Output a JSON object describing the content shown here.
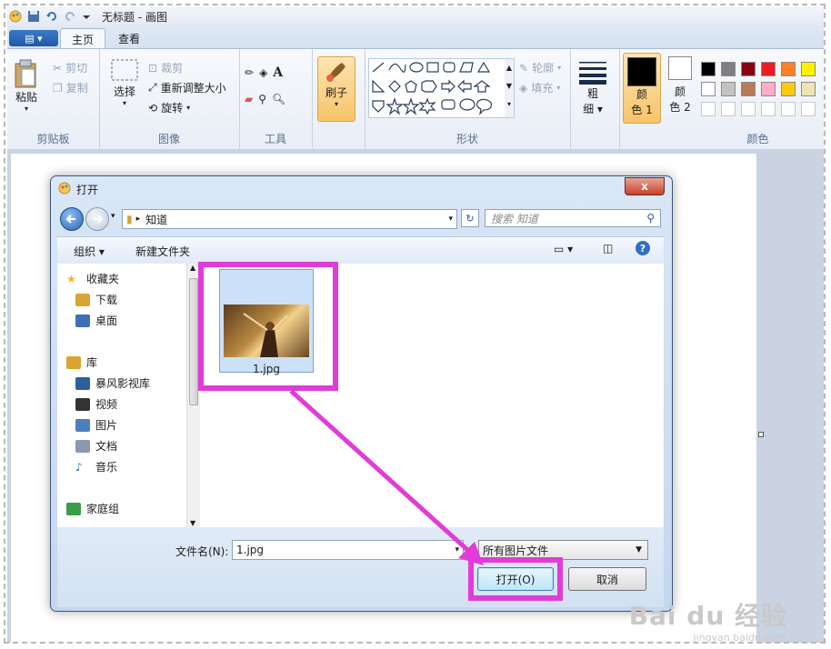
{
  "window": {
    "title": "无标题 - 画图"
  },
  "tabs": [
    {
      "label": "主页"
    },
    {
      "label": "查看"
    }
  ],
  "ribbon": {
    "clipboard": {
      "label": "剪贴板",
      "paste": "粘贴",
      "cut": "剪切",
      "copy": "复制"
    },
    "image": {
      "label": "图像",
      "select": "选择",
      "crop": "裁剪",
      "resize": "重新调整大小",
      "rotate": "旋转"
    },
    "tools": {
      "label": "工具"
    },
    "brush": {
      "label": "刷子"
    },
    "shapes": {
      "label": "形状",
      "outline": "轮廓",
      "fill": "填充"
    },
    "size": {
      "line1": "粗",
      "line2": "细"
    },
    "colors": {
      "label": "颜色",
      "color1_line1": "颜",
      "color1_line2": "色 1",
      "color2_line1": "颜",
      "color2_line2": "色 2",
      "color1_value": "#000000",
      "color2_value": "#ffffff",
      "palette": [
        "#000000",
        "#7f7f7f",
        "#880015",
        "#ed1c24",
        "#ff7f27",
        "#fff200",
        "#ffffff",
        "#c3c3c3",
        "#b97a57",
        "#ffaec9",
        "#ffc90e",
        "#efe4b0"
      ]
    }
  },
  "dialog": {
    "title": "打开",
    "address": "知道",
    "search_placeholder": "搜索 知道",
    "toolbar": {
      "organize": "组织 ▾",
      "new_folder": "新建文件夹"
    },
    "nav": [
      {
        "label": "收藏夹",
        "icon": "star-icon"
      },
      {
        "label": "下载",
        "icon": "download-folder-icon"
      },
      {
        "label": "桌面",
        "icon": "desktop-icon"
      },
      {
        "label": "库",
        "icon": "library-icon"
      },
      {
        "label": "暴风影视库",
        "icon": "video-library-icon"
      },
      {
        "label": "视频",
        "icon": "video-icon"
      },
      {
        "label": "图片",
        "icon": "picture-icon"
      },
      {
        "label": "文档",
        "icon": "document-icon"
      },
      {
        "label": "音乐",
        "icon": "music-icon"
      },
      {
        "label": "家庭组",
        "icon": "homegroup-icon"
      }
    ],
    "file": {
      "name": "1.jpg"
    },
    "filename_label": "文件名(N):",
    "filename_value": "1.jpg",
    "filetype_value": "所有图片文件",
    "open_button": "打开(O)",
    "cancel_button": "取消",
    "close_symbol": "x"
  },
  "watermark": {
    "brand": "Bai du 经验",
    "url": "jingyan.baidu.com"
  },
  "highlight_color": "#e13cd8"
}
